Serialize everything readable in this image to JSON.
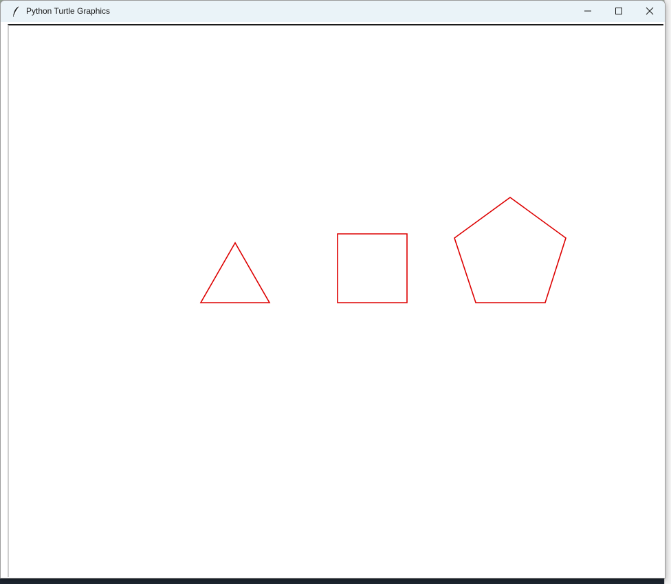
{
  "window": {
    "title": "Python Turtle Graphics",
    "icon": "feather-icon",
    "controls": [
      "minimize-icon",
      "maximize-icon",
      "close-icon"
    ]
  },
  "canvas": {
    "background": "#ffffff",
    "pen_color": "#dd0000",
    "shapes": [
      {
        "name": "triangle",
        "sides": 3
      },
      {
        "name": "square",
        "sides": 4
      },
      {
        "name": "pentagon",
        "sides": 5
      }
    ]
  }
}
